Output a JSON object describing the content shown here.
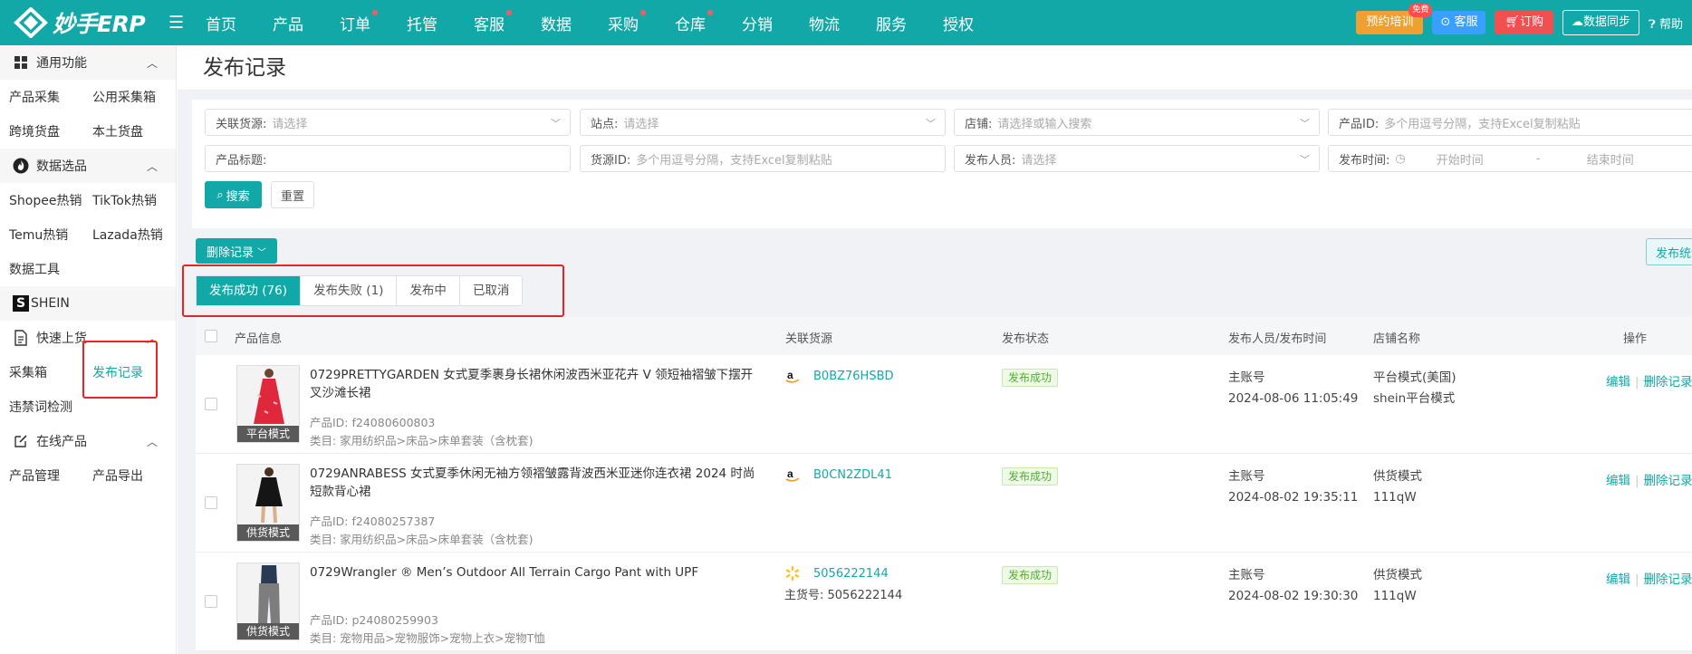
{
  "brand": {
    "name": "妙手ERP",
    "accent": "#13a8a8"
  },
  "nav": [
    {
      "label": "首页",
      "dot": false
    },
    {
      "label": "产品",
      "dot": false
    },
    {
      "label": "订单",
      "dot": true
    },
    {
      "label": "托管",
      "dot": false
    },
    {
      "label": "客服",
      "dot": true
    },
    {
      "label": "数据",
      "dot": false
    },
    {
      "label": "采购",
      "dot": true
    },
    {
      "label": "仓库",
      "dot": true
    },
    {
      "label": "分销",
      "dot": false
    },
    {
      "label": "物流",
      "dot": false
    },
    {
      "label": "服务",
      "dot": false
    },
    {
      "label": "授权",
      "dot": false
    }
  ],
  "top_right": {
    "training": "预约培训",
    "free_badge": "免费",
    "service": "客服",
    "order": "订购",
    "sync": "数据同步",
    "help": "帮助"
  },
  "sidebar": {
    "group_common": "通用功能",
    "product_collect": "产品采集",
    "public_box": "公用采集箱",
    "cross_border": "跨境货盘",
    "local_pallet": "本土货盘",
    "group_data": "数据选品",
    "shopee_hot": "Shopee热销",
    "tiktok_hot": "TikTok热销",
    "temu_hot": "Temu热销",
    "lazada_hot": "Lazada热销",
    "data_tools": "数据工具",
    "shein": "SHEIN",
    "group_quick": "快速上货",
    "collect_box": "采集箱",
    "publish_record": "发布记录",
    "banned_words": "违禁词检测",
    "group_online": "在线产品",
    "product_manage": "产品管理",
    "product_export": "产品导出"
  },
  "page": {
    "title": "发布记录"
  },
  "filters": {
    "source": {
      "label": "关联货源:",
      "placeholder": "请选择"
    },
    "site": {
      "label": "站点:",
      "placeholder": "请选择"
    },
    "store": {
      "label": "店铺:",
      "placeholder": "请选择或输入搜索"
    },
    "product_id": {
      "label": "产品ID:",
      "placeholder": "多个用逗号分隔，支持Excel复制粘贴"
    },
    "product_title": {
      "label": "产品标题:",
      "placeholder": ""
    },
    "source_id": {
      "label": "货源ID:",
      "placeholder": "多个用逗号分隔，支持Excel复制粘贴"
    },
    "publisher": {
      "label": "发布人员:",
      "placeholder": "请选择"
    },
    "publish_time": {
      "label": "发布时间:",
      "start": "开始时间",
      "dash": "-",
      "end": "结束时间"
    },
    "search_btn": "搜索",
    "reset_btn": "重置"
  },
  "actions": {
    "delete_records": "删除记录",
    "publish_stats": "发布统计"
  },
  "tabs": [
    {
      "label": "发布成功 (76)",
      "active": true
    },
    {
      "label": "发布失败 (1)",
      "active": false
    },
    {
      "label": "发布中",
      "active": false
    },
    {
      "label": "已取消",
      "active": false
    }
  ],
  "table": {
    "headers": {
      "product_info": "产品信息",
      "source": "关联货源",
      "status": "发布状态",
      "publisher_time": "发布人员/发布时间",
      "store_name": "店铺名称",
      "ops": "操作"
    },
    "rows": [
      {
        "mode": "平台模式",
        "title": "0729PRETTYGARDEN 女式夏季裹身长裙休闲波西米亚花卉 V 领短袖褶皱下摆开叉沙滩长裙",
        "product_id": "产品ID: f24080600803",
        "category": "类目: 家用纺织品>床品>床单套装（含枕套)",
        "source_type": "amazon",
        "source_id": "B0BZ76HSBD",
        "source_sub": "",
        "status": "发布成功",
        "publisher": "主账号",
        "time": "2024-08-06 11:05:49",
        "store_line1": "平台模式(美国)",
        "store_line2": "shein平台模式",
        "edit": "编辑",
        "delete": "删除记录"
      },
      {
        "mode": "供货模式",
        "title": "0729ANRABESS 女式夏季休闲无袖方领褶皱露背波西米亚迷你连衣裙 2024 时尚短款背心裙",
        "product_id": "产品ID: f24080257387",
        "category": "类目: 家用纺织品>床品>床单套装（含枕套)",
        "source_type": "amazon",
        "source_id": "B0CN2ZDL41",
        "source_sub": "",
        "status": "发布成功",
        "publisher": "主账号",
        "time": "2024-08-02 19:35:11",
        "store_line1": "供货模式",
        "store_line2": "111qW",
        "edit": "编辑",
        "delete": "删除记录"
      },
      {
        "mode": "供货模式",
        "title": "0729Wrangler ® Men’s Outdoor All Terrain Cargo Pant with UPF",
        "product_id": "产品ID: p24080259903",
        "category": "类目: 宠物用品>宠物服饰>宠物上衣>宠物T恤",
        "source_type": "walmart",
        "source_id": "5056222144",
        "source_sub": "主货号: 5056222144",
        "status": "发布成功",
        "publisher": "主账号",
        "time": "2024-08-02 19:30:30",
        "store_line1": "供货模式",
        "store_line2": "111qW",
        "edit": "编辑",
        "delete": "删除记录"
      }
    ]
  }
}
